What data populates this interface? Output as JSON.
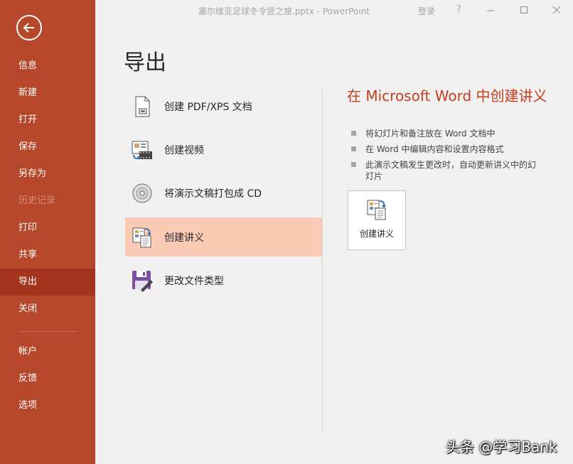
{
  "titlebar": {
    "document_title": "塞尔维亚足球冬令营之旅.pptx  -  PowerPoint",
    "login_label": "登录",
    "help_label": "?",
    "minimize_icon": "minimize-icon",
    "restore_icon": "restore-icon",
    "close_icon": "close-icon"
  },
  "sidebar": {
    "back_icon": "back-arrow-icon",
    "accent_color": "#b7472a",
    "items": [
      {
        "label": "信息",
        "state": "normal"
      },
      {
        "label": "新建",
        "state": "normal"
      },
      {
        "label": "打开",
        "state": "normal"
      },
      {
        "label": "保存",
        "state": "normal"
      },
      {
        "label": "另存为",
        "state": "normal"
      },
      {
        "label": "历史记录",
        "state": "disabled"
      },
      {
        "label": "打印",
        "state": "normal"
      },
      {
        "label": "共享",
        "state": "normal"
      },
      {
        "label": "导出",
        "state": "active"
      },
      {
        "label": "关闭",
        "state": "normal"
      },
      {
        "label": "帐户",
        "state": "normal"
      },
      {
        "label": "反馈",
        "state": "normal"
      },
      {
        "label": "选项",
        "state": "normal"
      }
    ]
  },
  "main": {
    "title": "导出",
    "options": [
      {
        "label": "创建 PDF/XPS 文档",
        "icon": "pdf-document-icon"
      },
      {
        "label": "创建视频",
        "icon": "video-icon"
      },
      {
        "label": "将演示文稿打包成 CD",
        "icon": "cd-icon"
      },
      {
        "label": "创建讲义",
        "icon": "handout-icon",
        "selected": true
      },
      {
        "label": "更改文件类型",
        "icon": "save-as-type-icon"
      }
    ]
  },
  "detail": {
    "title": "在 Microsoft Word 中创建讲义",
    "bullets": [
      "将幻灯片和备注放在 Word 文档中",
      "在 Word 中编辑内容和设置内容格式",
      "此演示文稿发生更改时，自动更新讲义中的幻灯片"
    ],
    "button_label": "创建讲义",
    "button_icon": "handout-icon",
    "title_color": "#c43e1c"
  },
  "watermark": "头条 @学习Bank"
}
